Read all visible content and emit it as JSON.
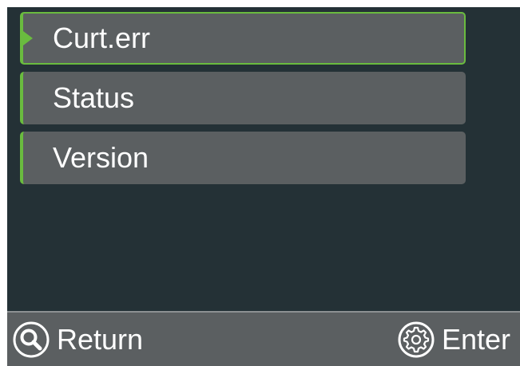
{
  "menu": {
    "items": [
      {
        "label": "Curt.err",
        "selected": true
      },
      {
        "label": "Status",
        "selected": false
      },
      {
        "label": "Version",
        "selected": false
      }
    ]
  },
  "bottom_bar": {
    "return_label": "Return",
    "return_icon": "search-icon",
    "enter_label": "Enter",
    "enter_icon": "gear-icon"
  },
  "colors": {
    "screen_background": "#243136",
    "item_background": "#5b5f61",
    "accent": "#6abb3f",
    "text": "#ffffff"
  }
}
